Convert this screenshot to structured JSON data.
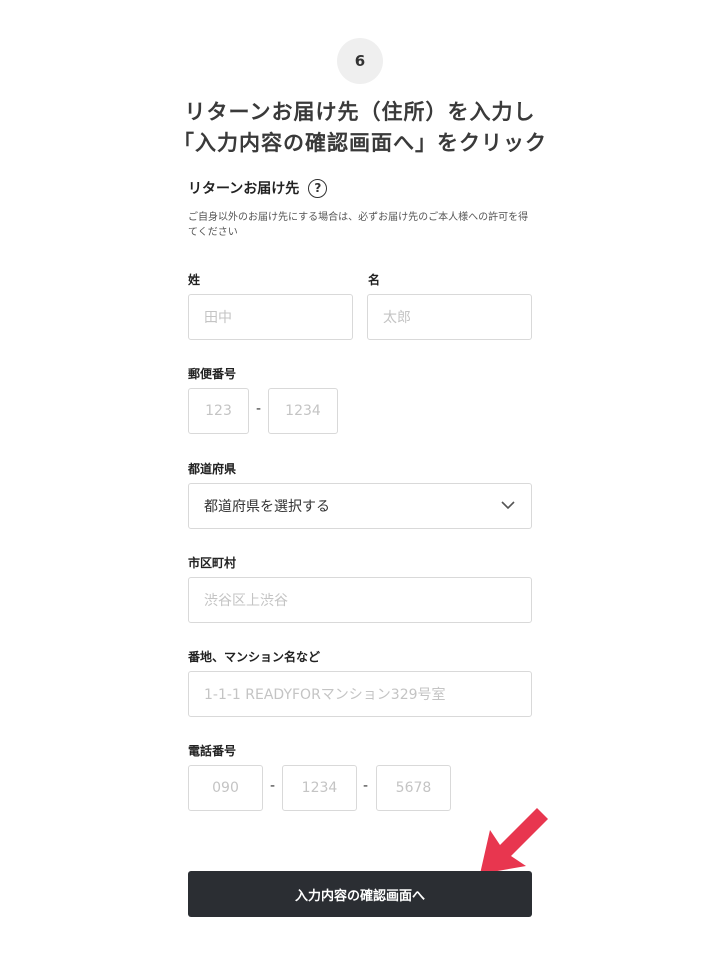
{
  "step": {
    "number": "6"
  },
  "instruction": {
    "line1": "リターンお届け先（住所）を入力し",
    "line2": "「入力内容の確認画面へ」をクリック"
  },
  "section": {
    "title": "リターンお届け先",
    "help_icon": "question-circle-icon",
    "note": "ご自身以外のお届け先にする場合は、必ずお届け先のご本人様への許可を得てください"
  },
  "fields": {
    "last_name": {
      "label": "姓",
      "placeholder": "田中"
    },
    "first_name": {
      "label": "名",
      "placeholder": "太郎"
    },
    "postal": {
      "label": "郵便番号",
      "part1": "123",
      "separator": "-",
      "part2": "1234"
    },
    "prefecture": {
      "label": "都道府県",
      "value": "都道府県を選択する",
      "icon": "chevron-down-icon"
    },
    "city": {
      "label": "市区町村",
      "placeholder": "渋谷区上渋谷"
    },
    "address": {
      "label": "番地、マンション名など",
      "placeholder": "1-1-1 READYFORマンション329号室"
    },
    "phone": {
      "label": "電話番号",
      "part1": "090",
      "separator": "-",
      "part2": "1234",
      "part3": "5678"
    }
  },
  "button": {
    "label": "入力内容の確認画面へ"
  },
  "colors": {
    "arrow": "#e8364f",
    "button_bg": "#2b2e33",
    "placeholder": "#c4c4c4"
  }
}
